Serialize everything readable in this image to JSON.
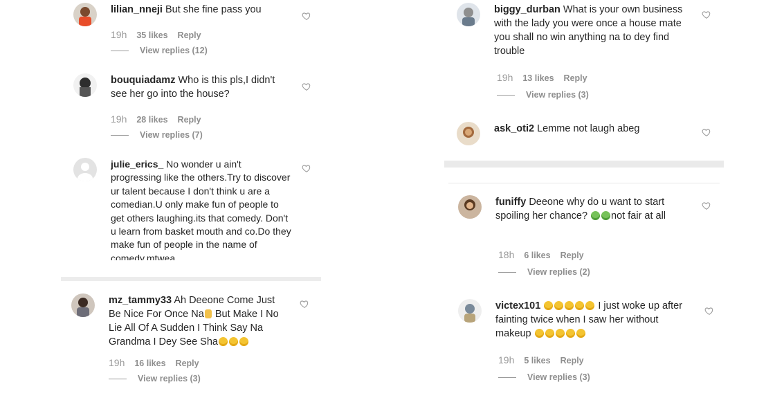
{
  "left_column": [
    {
      "username": "lilian_nneji",
      "text": "But she fine pass you",
      "time": "19h",
      "likes": "35 likes",
      "reply": "Reply",
      "view_replies": "View replies (12)"
    },
    {
      "username": "bouquiadamz",
      "text": "Who is this pls,I didn't see her go into the house?",
      "time": "19h",
      "likes": "28 likes",
      "reply": "Reply",
      "view_replies": "View replies (7)"
    },
    {
      "username": "julie_erics_",
      "text": "No wonder u ain't progressing like the others.Try to discover ur talent because I don't think u are a comedian.U only make fun of people to get others laughing.its that comedy. Don't u learn from basket mouth and co.Do they make fun of people in the name of comedy.mtwea"
    },
    {
      "username": "mz_tammy33",
      "text_1": "Ah Deeone Come Just Be Nice For Once Na",
      "text_2": "But Make I No Lie All Of A Sudden I Think Say Na Grandma I Dey See Sha",
      "time": "19h",
      "likes": "16 likes",
      "reply": "Reply",
      "view_replies": "View replies (3)"
    }
  ],
  "right_column": [
    {
      "username": "biggy_durban",
      "text": "What is your own business with the lady you were once a house mate you shall no win anything na to dey find trouble",
      "time": "19h",
      "likes": "13 likes",
      "reply": "Reply",
      "view_replies": "View replies (3)"
    },
    {
      "username": "ask_oti2",
      "text": "Lemme not laugh abeg"
    },
    {
      "username": "funiffy",
      "text_1": "Deeone why do u want to start spoiling her chance?",
      "text_2": "not fair at all",
      "time": "18h",
      "likes": "6 likes",
      "reply": "Reply",
      "view_replies": "View replies (2)"
    },
    {
      "username": "victex101",
      "text_1": "I just woke up after fainting twice when I saw her without makeup",
      "time": "19h",
      "likes": "5 likes",
      "reply": "Reply",
      "view_replies": "View replies (3)"
    }
  ],
  "icons": {
    "heart": "heart-outline-icon",
    "laugh": "face-with-tears-of-joy-emoji",
    "sick": "nauseated-face-emoji",
    "pray": "folded-hands-emoji"
  },
  "colors": {
    "text": "#262626",
    "meta": "#8e8e8e",
    "separator": "#e6e6e6"
  }
}
